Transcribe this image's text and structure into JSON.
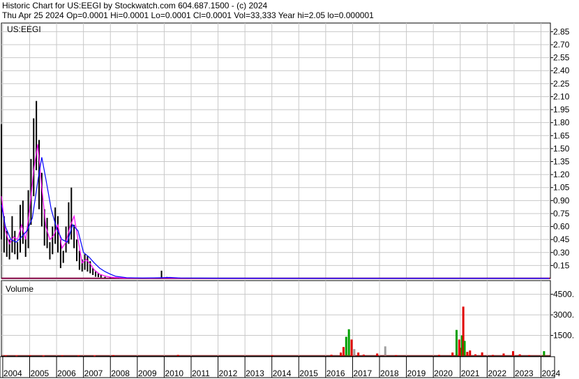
{
  "header": {
    "line1": "Historic Chart for US:EEGI by Stockwatch.com 604.687.1500 - (c) 2024",
    "line2": "Thu Apr 25 2024   Op=0.0001   Hi=0.0001   Lo=0.0001   Cl=0.0001   Vol=33,333   Year hi=2.05   lo=0.000001"
  },
  "colors": {
    "background": "#ffffff",
    "grid": "#c8c8c8",
    "price_bar": "#000000",
    "ma_short": "#ff00ff",
    "ma_long": "#0000ff",
    "floor_line": "#800040",
    "volume_up": "#00a000",
    "volume_down": "#e00000",
    "volume_other": "#a0a0a0"
  },
  "chart_data": [
    {
      "type": "line",
      "panel": "price",
      "title": "US:EEGI",
      "ylim": [
        0,
        2.95
      ],
      "y_ticks": [
        "2.85",
        "2.70",
        "2.55",
        "2.40",
        "2.25",
        "2.10",
        "1.95",
        "1.80",
        "1.65",
        "1.50",
        "1.35",
        "1.20",
        "1.05",
        "0.90",
        "0.75",
        "0.60",
        "0.45",
        "0.30",
        "0.15"
      ],
      "y_tick_values": [
        2.85,
        2.7,
        2.55,
        2.4,
        2.25,
        2.1,
        1.95,
        1.8,
        1.65,
        1.5,
        1.35,
        1.2,
        1.05,
        0.9,
        0.75,
        0.6,
        0.45,
        0.3,
        0.15
      ],
      "x_labels": [
        "2004",
        "2005",
        "2006",
        "2007",
        "2008",
        "2009",
        "2010",
        "2011",
        "2012",
        "2013",
        "2014",
        "2015",
        "2016",
        "2017",
        "2018",
        "2019",
        "2020",
        "2021",
        "2022",
        "2023",
        "2024"
      ],
      "x_label_years": [
        2004,
        2005,
        2006,
        2007,
        2008,
        2009,
        2010,
        2011,
        2012,
        2013,
        2014,
        2015,
        2016,
        2017,
        2018,
        2019,
        2020,
        2021,
        2022,
        2023,
        2024
      ],
      "xlim": [
        2003.95,
        2024.35
      ],
      "series": [
        {
          "color": "#000000",
          "style": "high-low bars",
          "x": [
            2003.95,
            2004.05,
            2004.15,
            2004.25,
            2004.35,
            2004.45,
            2004.55,
            2004.65,
            2004.75,
            2004.85,
            2004.95,
            2005.05,
            2005.15,
            2005.25,
            2005.35,
            2005.45,
            2005.55,
            2005.65,
            2005.75,
            2005.85,
            2005.95,
            2006.05,
            2006.15,
            2006.25,
            2006.35,
            2006.45,
            2006.55,
            2006.65,
            2006.75,
            2006.85,
            2006.95,
            2007.05,
            2007.15,
            2007.25,
            2007.35,
            2007.45,
            2007.55,
            2007.65,
            2007.8,
            2008.0,
            2008.3,
            2008.7,
            2009.2,
            2009.6,
            2009.9,
            2010.1,
            2010.4,
            2010.8,
            2011.5,
            2013.0,
            2015.0,
            2017.0,
            2019.0,
            2020.9,
            2021.5,
            2022.5,
            2024.3
          ],
          "high": [
            1.78,
            0.72,
            0.55,
            0.45,
            0.72,
            0.55,
            0.42,
            0.85,
            0.9,
            0.48,
            1.02,
            1.38,
            1.85,
            2.05,
            1.6,
            1.22,
            0.8,
            0.7,
            0.42,
            0.6,
            0.82,
            0.72,
            0.45,
            0.32,
            0.6,
            0.88,
            1.05,
            0.62,
            0.45,
            0.32,
            0.22,
            0.28,
            0.26,
            0.2,
            0.12,
            0.08,
            0.06,
            0.04,
            0.02,
            0.012,
            0.006,
            0.004,
            0.006,
            0.01,
            0.09,
            0.018,
            0.01,
            0.004,
            0.002,
            0.001,
            0.001,
            0.001,
            0.001,
            0.001,
            0.002,
            0.001,
            0.0001
          ],
          "low": [
            0.45,
            0.3,
            0.25,
            0.22,
            0.3,
            0.28,
            0.22,
            0.3,
            0.4,
            0.25,
            0.35,
            0.62,
            0.95,
            1.25,
            0.8,
            0.6,
            0.38,
            0.35,
            0.22,
            0.28,
            0.4,
            0.3,
            0.12,
            0.18,
            0.3,
            0.4,
            0.45,
            0.35,
            0.2,
            0.1,
            0.08,
            0.1,
            0.08,
            0.06,
            0.04,
            0.02,
            0.015,
            0.01,
            0.005,
            0.002,
            0.001,
            0.001,
            0.001,
            0.002,
            0.004,
            0.002,
            0.001,
            0.0005,
            0.0002,
            0.0001,
            0.0001,
            0.0001,
            0.0001,
            0.0001,
            0.0001,
            0.0001,
            0.0001
          ]
        },
        {
          "color": "#ff00ff",
          "style": "line",
          "x": [
            2003.95,
            2004.1,
            2004.25,
            2004.4,
            2004.55,
            2004.7,
            2004.85,
            2005.0,
            2005.15,
            2005.3,
            2005.45,
            2005.6,
            2005.75,
            2005.9,
            2006.05,
            2006.2,
            2006.35,
            2006.5,
            2006.65,
            2006.8,
            2006.95,
            2007.1,
            2007.25,
            2007.4,
            2007.6,
            2007.8,
            2008.0,
            2008.5,
            2009.5,
            2010.0,
            2010.5,
            2012.0,
            2016.0,
            2020.0,
            2024.3
          ],
          "y": [
            0.95,
            0.55,
            0.4,
            0.48,
            0.45,
            0.62,
            0.45,
            0.8,
            1.25,
            1.55,
            1.05,
            0.6,
            0.45,
            0.5,
            0.62,
            0.35,
            0.42,
            0.6,
            0.72,
            0.45,
            0.18,
            0.22,
            0.17,
            0.1,
            0.05,
            0.03,
            0.015,
            0.006,
            0.004,
            0.008,
            0.004,
            0.002,
            0.001,
            0.001,
            0.001
          ]
        },
        {
          "color": "#0000ff",
          "style": "line",
          "x": [
            2003.95,
            2004.1,
            2004.3,
            2004.5,
            2004.7,
            2004.9,
            2005.1,
            2005.3,
            2005.45,
            2005.6,
            2005.8,
            2006.0,
            2006.2,
            2006.4,
            2006.6,
            2006.8,
            2007.0,
            2007.2,
            2007.4,
            2007.6,
            2007.8,
            2008.0,
            2008.2,
            2008.6,
            2009.2,
            2009.8,
            2010.2,
            2010.6,
            2012.0,
            2016.0,
            2020.0,
            2024.3
          ],
          "y": [
            0.85,
            0.6,
            0.45,
            0.42,
            0.48,
            0.55,
            0.7,
            1.12,
            1.4,
            1.15,
            0.8,
            0.58,
            0.45,
            0.42,
            0.62,
            0.55,
            0.3,
            0.25,
            0.18,
            0.12,
            0.08,
            0.05,
            0.025,
            0.01,
            0.006,
            0.008,
            0.012,
            0.006,
            0.003,
            0.001,
            0.001,
            0.001
          ]
        }
      ]
    },
    {
      "type": "bar",
      "panel": "volume",
      "title": "Volume",
      "ylim": [
        0,
        5500
      ],
      "y_ticks": [
        "4500.",
        "3000.",
        "1500."
      ],
      "y_tick_values": [
        4500,
        3000,
        1500
      ],
      "x": [
        2004.1,
        2004.5,
        2005.0,
        2005.5,
        2006.2,
        2006.8,
        2007.4,
        2008.1,
        2010.5,
        2014.0,
        2016.2,
        2016.55,
        2016.65,
        2016.75,
        2016.85,
        2016.95,
        2017.05,
        2017.2,
        2017.4,
        2017.9,
        2018.2,
        2018.6,
        2020.2,
        2020.7,
        2020.85,
        2020.95,
        2021.0,
        2021.05,
        2021.1,
        2021.15,
        2021.25,
        2021.35,
        2021.55,
        2021.8,
        2022.2,
        2022.6,
        2022.95,
        2023.2,
        2023.55,
        2024.1
      ],
      "values": [
        40,
        35,
        50,
        30,
        45,
        40,
        30,
        60,
        80,
        60,
        90,
        250,
        650,
        1400,
        1950,
        1200,
        500,
        250,
        100,
        180,
        700,
        60,
        80,
        250,
        1900,
        1200,
        600,
        1500,
        3600,
        1100,
        300,
        400,
        120,
        260,
        80,
        180,
        350,
        120,
        60,
        350
      ],
      "colors": [
        "down",
        "down",
        "down",
        "down",
        "down",
        "down",
        "down",
        "down",
        "down",
        "down",
        "down",
        "down",
        "down",
        "up",
        "up",
        "down",
        "other",
        "down",
        "down",
        "down",
        "other",
        "down",
        "down",
        "down",
        "up",
        "down",
        "down",
        "up",
        "down",
        "up",
        "down",
        "down",
        "down",
        "down",
        "down",
        "down",
        "down",
        "down",
        "down",
        "up"
      ]
    }
  ]
}
